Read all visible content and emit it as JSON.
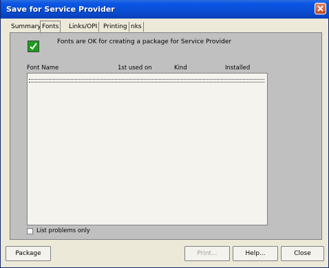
{
  "window": {
    "title": "Save for Service Provider"
  },
  "tabs": [
    {
      "label": "Summary"
    },
    {
      "label": "Fonts",
      "active": true
    },
    {
      "label": "Links/OPI"
    },
    {
      "label": "Printing"
    },
    {
      "label": "nks"
    }
  ],
  "fonts_panel": {
    "status_icon": "check-icon",
    "status_text": "Fonts are OK for creating a package for Service Provider",
    "columns": [
      "Font Name",
      "1st used on",
      "Kind",
      "Installed"
    ],
    "rows": [],
    "list_problems_label": "List problems only",
    "list_problems_checked": false
  },
  "buttons": {
    "package": "Package",
    "print": "Print...",
    "help": "Help...",
    "close": "Close"
  },
  "colors": {
    "titlebar": "#0a4fd6",
    "panel": "#c0c0c0",
    "status_icon": "#1c9c1c"
  }
}
